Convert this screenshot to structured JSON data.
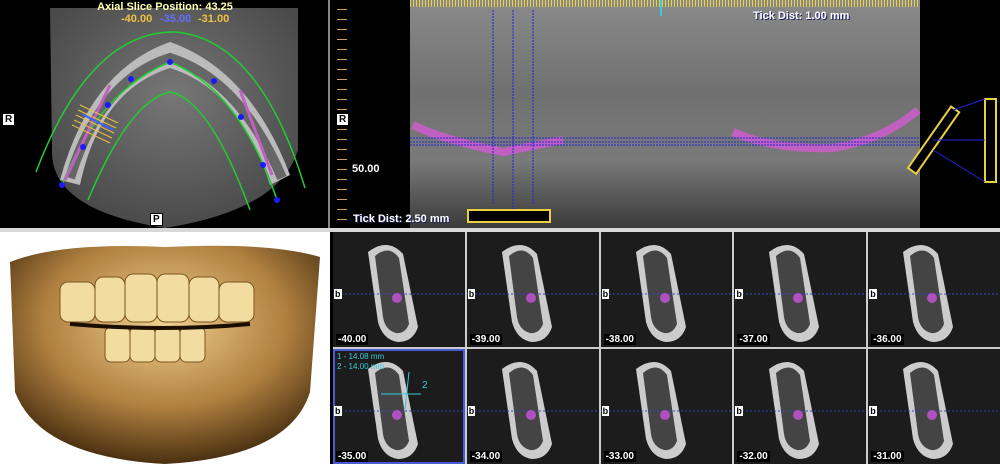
{
  "axial": {
    "title": "Axial Slice Position: 43.25",
    "range_start": "-40.00",
    "range_mid": "-35.00",
    "range_end": "-31.00",
    "label_right": "R",
    "label_posterior": "P"
  },
  "pano": {
    "tick_dist_top": "Tick Dist: 1.00 mm",
    "tick_dist_left": "Tick Dist: 2.50 mm",
    "ruler_value": "50.00",
    "label_right": "R"
  },
  "colors": {
    "nerve": "#c060c0",
    "curve": "#22cc33",
    "marker": "#1a1aff",
    "ruler": "#e8d040"
  },
  "cross_sections": [
    {
      "position": "-40.00",
      "label": "b"
    },
    {
      "position": "-39.00",
      "label": "b"
    },
    {
      "position": "-38.00",
      "label": "b"
    },
    {
      "position": "-37.00",
      "label": "b"
    },
    {
      "position": "-36.00",
      "label": "b"
    },
    {
      "position": "-35.00",
      "label": "b",
      "selected": true,
      "measurements": [
        "1 - 14.08 mm",
        "2 - 14.00 mm"
      ],
      "marker": "2"
    },
    {
      "position": "-34.00",
      "label": "b"
    },
    {
      "position": "-33.00",
      "label": "b"
    },
    {
      "position": "-32.00",
      "label": "b"
    },
    {
      "position": "-31.00",
      "label": "b"
    }
  ]
}
